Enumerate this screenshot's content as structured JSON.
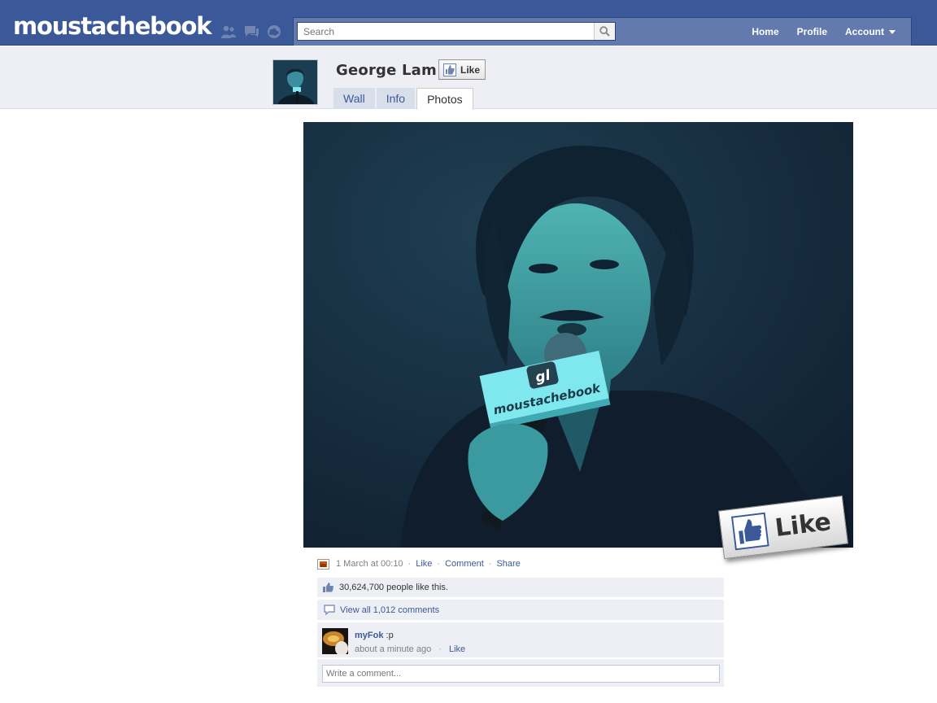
{
  "app": {
    "logo": "moustachebook"
  },
  "icons": {
    "jewels": [
      "friend-requests-icon",
      "messages-icon",
      "notifications-icon"
    ],
    "search": "search-icon"
  },
  "search": {
    "placeholder": "Search"
  },
  "nav": {
    "home": "Home",
    "profile": "Profile",
    "account": "Account"
  },
  "profile": {
    "name": "George Lam",
    "like_label": "Like",
    "tabs": [
      {
        "label": "Wall",
        "active": false
      },
      {
        "label": "Info",
        "active": false
      },
      {
        "label": "Photos",
        "active": true
      }
    ]
  },
  "photo": {
    "microphone_logo": "gl",
    "microphone_text": "moustachebook",
    "overlay_like": "Like"
  },
  "post": {
    "timestamp": "1 March at 00:10",
    "actions": {
      "like": "Like",
      "comment": "Comment",
      "share": "Share"
    },
    "likes": {
      "count_text": "30,624,700 people",
      "suffix": "like this."
    },
    "view_comments": "View all 1,012 comments",
    "comment": {
      "author": "myFok",
      "text": ":p",
      "time": "about a minute ago",
      "like": "Like"
    },
    "write_placeholder": "Write a comment..."
  },
  "colors": {
    "brand_blue": "#3b5998",
    "bar_blue": "#627aad",
    "header_bg": "#edeff4",
    "tab_bg": "#d8dfea"
  }
}
